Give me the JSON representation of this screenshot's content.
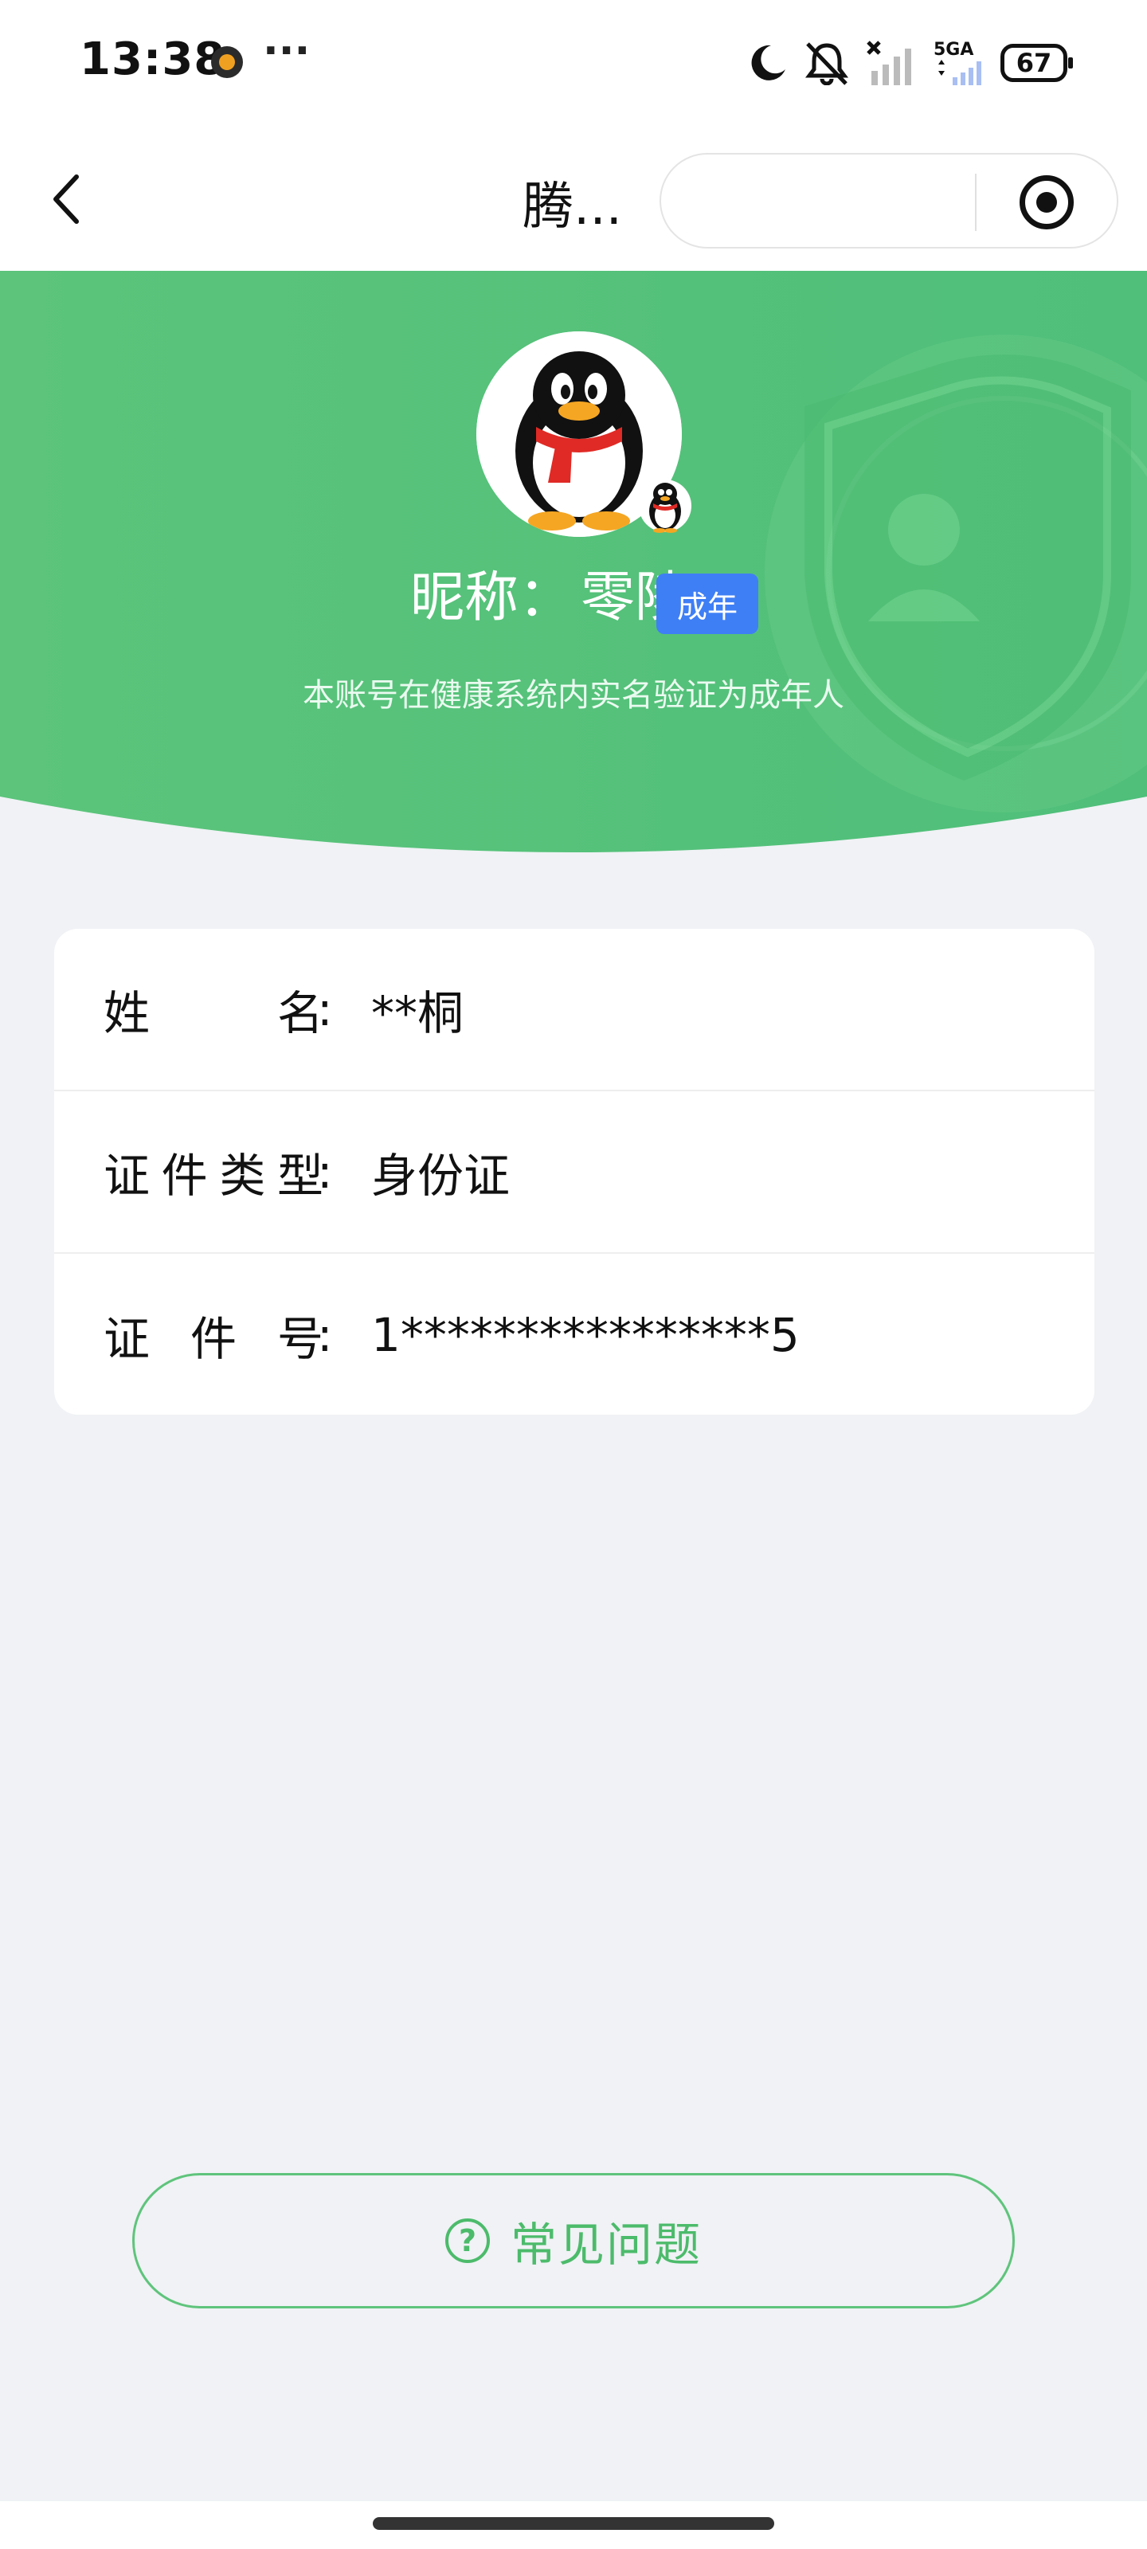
{
  "status_bar": {
    "time": "13:38",
    "more": "···",
    "network": "5GA",
    "battery": "67",
    "icons": [
      "app-notification-icon",
      "moon-icon",
      "bell-muted-icon",
      "signal-off-icon",
      "5g-signal-icon",
      "battery-icon"
    ]
  },
  "nav": {
    "title": "腾...",
    "back_icon": "chevron-left-icon",
    "capsule_icons": [
      "more-icon",
      "target-icon"
    ]
  },
  "profile": {
    "nickname_label": "昵称：",
    "nickname": "零陵",
    "badge": "成年",
    "description": "本账号在健康系统内实名验证为成年人"
  },
  "info": {
    "rows": [
      {
        "label_chars": [
          "姓",
          "名"
        ],
        "value": "**桐"
      },
      {
        "label_chars": [
          "证",
          "件",
          "类",
          "型"
        ],
        "value": "身份证"
      },
      {
        "label_chars": [
          "证",
          "件",
          "号"
        ],
        "value": "1****************5"
      }
    ],
    "colon": ":"
  },
  "faq": {
    "icon": "?",
    "label": "常见问题"
  },
  "colors": {
    "banner_green": "#56c27a",
    "accent_green": "#4cbb6b",
    "badge_blue": "#3f7ff5",
    "page_bg": "#f0f2f5"
  }
}
